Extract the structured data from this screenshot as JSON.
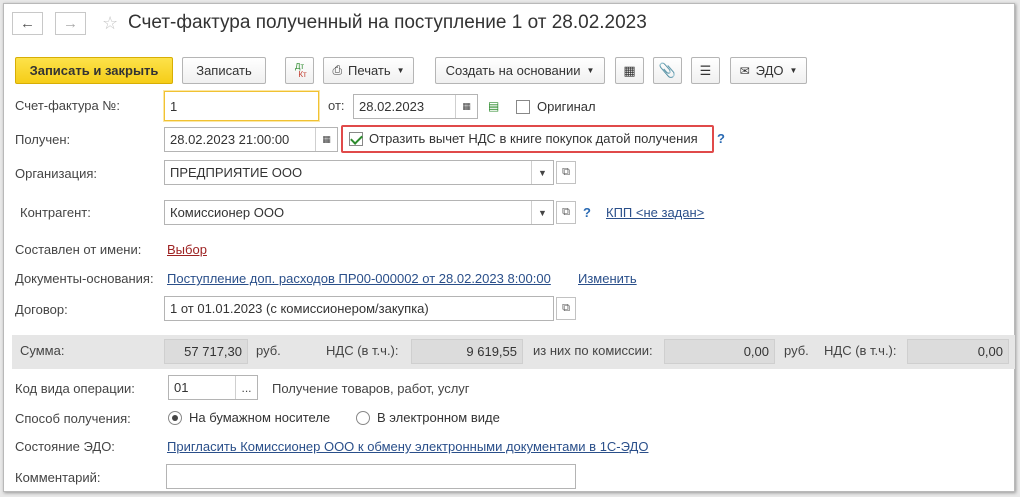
{
  "window": {
    "title": "Счет-фактура полученный на поступление 1 от 28.02.2023"
  },
  "toolbar": {
    "save_close_label": "Записать и закрыть",
    "save_label": "Записать",
    "dt_kt_top": "Дт",
    "dt_kt_bottom": "Кт",
    "print_label": "Печать",
    "create_based_label": "Создать на основании",
    "edo_label": "ЭДО"
  },
  "form": {
    "invoice_number_label": "Счет-фактура №:",
    "invoice_number_value": "1",
    "date_from_label": "от:",
    "date_from_value": "28.02.2023",
    "original_label": "Оригинал",
    "original_checked": false,
    "received_label": "Получен:",
    "received_value": "28.02.2023 21:00:00",
    "vat_deduction_label": "Отразить вычет НДС в книге покупок датой получения",
    "vat_deduction_checked": true,
    "organization_label": "Организация:",
    "organization_value": "ПРЕДПРИЯТИЕ ООО",
    "counterparty_label": "Контрагент:",
    "counterparty_value": "Комиссионер ООО",
    "kpp_link": "КПП <не задан>",
    "composed_on_behalf_label": "Составлен от имени:",
    "composed_on_behalf_link": "Выбор",
    "base_documents_label": "Документы-основания:",
    "base_documents_link": "Поступление доп. расходов ПР00-000002 от 28.02.2023 8:00:00",
    "change_link": "Изменить",
    "contract_label": "Договор:",
    "contract_value": "1 от 01.01.2023 (с комиссионером/закупка)",
    "operation_code_label": "Код вида операции:",
    "operation_code_value": "01",
    "operation_code_desc": "Получение товаров, работ, услуг",
    "receipt_method_label": "Способ получения:",
    "receipt_method_paper": "На бумажном носителе",
    "receipt_method_electronic": "В электронном виде",
    "receipt_method_selected": "paper",
    "edo_state_label": "Состояние ЭДО:",
    "edo_state_link": "Пригласить Комиссионер ООО к обмену электронными документами в 1С-ЭДО",
    "comment_label": "Комментарий:",
    "comment_value": ""
  },
  "sums": {
    "sum_label": "Сумма:",
    "sum_value": "57 717,30",
    "currency1": "руб.",
    "vat_label1": "НДС (в т.ч.):",
    "vat_value1": "9 619,55",
    "commission_label": "из них по комиссии:",
    "commission_value": "0,00",
    "currency2": "руб.",
    "vat_label2": "НДС (в т.ч.):",
    "vat_value2": "0,00"
  },
  "colors": {
    "primary_button": "#f5cd18",
    "link": "#2a4f8a",
    "highlight_border": "#e04a4a"
  }
}
